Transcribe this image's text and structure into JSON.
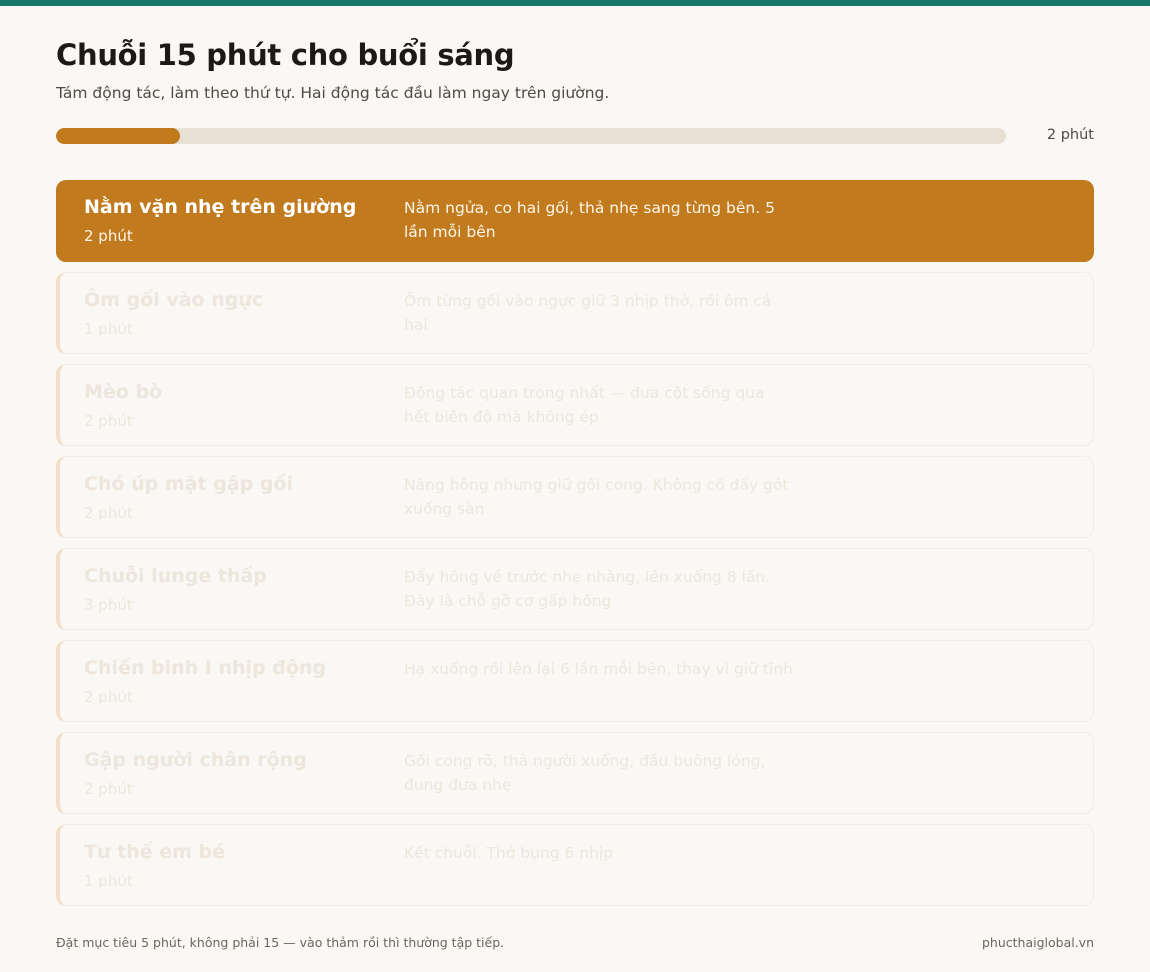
{
  "header": {
    "title": "Chuỗi 15 phút cho buổi sáng",
    "subtitle": "Tám động tác, làm theo thứ tự. Hai động tác đầu làm ngay trên giường."
  },
  "progress": {
    "fraction": 0.13,
    "label": "2 phút"
  },
  "steps": [
    {
      "name": "Nằm vặn nhẹ trên giường",
      "duration": "2 phút",
      "description": "Nằm ngửa, co hai gối, thả nhẹ sang từng bên. 5 lần mỗi bên",
      "active": true
    },
    {
      "name": "Ôm gối vào ngực",
      "duration": "1 phút",
      "description": "Ôm từng gối vào ngực giữ 3 nhịp thở, rồi ôm cả hai",
      "active": false
    },
    {
      "name": "Mèo bò",
      "duration": "2 phút",
      "description": "Động tác quan trọng nhất — đưa cột sống qua hết biên độ mà không ép",
      "active": false
    },
    {
      "name": "Chó úp mặt gập gối",
      "duration": "2 phút",
      "description": "Nâng hông nhưng giữ gối cong. Không cố đẩy gót xuống sàn",
      "active": false
    },
    {
      "name": "Chuỗi lunge thấp",
      "duration": "3 phút",
      "description": "Đẩy hông về trước nhẹ nhàng, lên xuống 8 lần. Đây là chỗ gỡ cơ gấp hông",
      "active": false
    },
    {
      "name": "Chiến binh I nhịp động",
      "duration": "2 phút",
      "description": "Hạ xuống rồi lên lại 6 lần mỗi bên, thay vì giữ tĩnh",
      "active": false
    },
    {
      "name": "Gập người chân rộng",
      "duration": "2 phút",
      "description": "Gối cong rõ, thả người xuống, đầu buông lỏng, đung đưa nhẹ",
      "active": false
    },
    {
      "name": "Tư thế em bé",
      "duration": "1 phút",
      "description": "Kết chuỗi. Thở bụng 6 nhịp",
      "active": false
    }
  ],
  "footer": {
    "note": "Đặt mục tiêu 5 phút, không phải 15 — vào thảm rồi thì thường tập tiếp.",
    "site": "phucthaiglobal.vn"
  },
  "colors": {
    "accent": "#c17a1e",
    "topbar": "#17756b",
    "background": "#faf8f4"
  }
}
